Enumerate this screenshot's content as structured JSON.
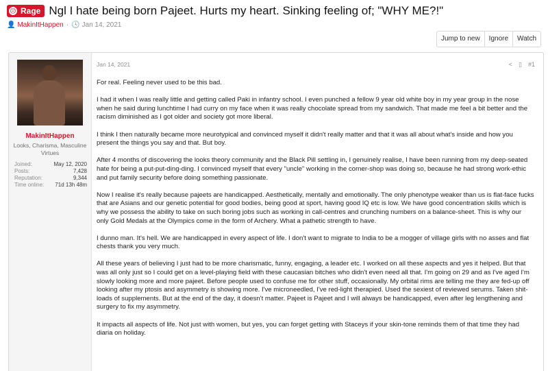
{
  "thread": {
    "prefix": "Rage",
    "prefix_color": "#d4172a",
    "title": "Ngl I hate being born Pajeet. Hurts my heart. Sinking feeling of; \"WHY ME?!\"",
    "author": "MakinItHappen",
    "date": "Jan 14, 2021",
    "author_icon": "user-icon",
    "date_icon": "clock-icon"
  },
  "actions": {
    "jump_to_new": "Jump to new",
    "ignore": "Ignore",
    "watch": "Watch"
  },
  "post": {
    "date": "Jan 14, 2021",
    "number": "#1",
    "share_icon": "share-icon",
    "bookmark_icon": "bookmark-icon",
    "user": {
      "name": "MakinItHappen",
      "title": "Looks, Charisma, Masculine Virtues",
      "stats": [
        {
          "label": "Joined:",
          "value": "May 12, 2020"
        },
        {
          "label": "Posts:",
          "value": "7,428"
        },
        {
          "label": "Reputation:",
          "value": "9,344"
        },
        {
          "label": "Time online:",
          "value": "71d 13h 48m"
        }
      ]
    },
    "paragraphs": [
      "For real. Feeling never used to be this bad.",
      "I had it when I was really little and getting called Paki in infantry school. I even punched a fellow 9 year old white boy in my year group in the nose when he said during lunchtime I had curry on my face when it was really chocolate spread from my sandwich. That made me feel a bit better and the racism diminished as I got older and society got more liberal.",
      "I think I then naturally became more neurotypical and convinced myself it didn't really matter and that it was all about what's inside and how you present the things you say and that. But boy.",
      "After 4 months of discovering the looks theory community and the Black Pill settling in, I genuinely realise, I have been running from my deep-seated hate for being a put-put-ding-ding. I convinced myself that every \"uncle\" working in the corner-shop was doing so, because he had strong work-ethic and put family security before doing something passionate.",
      "Now I realise it's really because pajeets are handicapped. Aesthetically, mentally and emotionally. The only phenotype weaker than us is flat-face fucks that are Asians and our genetic potential for good bodies, being good at sport, having good IQ etc is low. We have good concentration skills which is why we possess the ability to take on such boring jobs such as working in call-centres and crunching numbers on a balance-sheet. This is why our only Gold Medals at the Olympics come in the form of Archery. What a pathetic strength to have.",
      "I dunno man. It's hell. We are handicapped in every aspect of life. I don't want to migrate to India to be a mogger of village girls with no asses and flat chests thank you very much.",
      "All these years of believing I just had to be more charismatic, funny, engaging, a leader etc. I worked on all these aspects and yes it helped. But that was all only just so I could get on a level-playing field with these caucasian bitches who didn't even need all that. I'm going on 29 and as I've aged I'm slowly looking more and more pajeet. Before people used to confuse me for other stuff, occasionally. My orbital rims are telling me they are fed-up off looking after my ptosis and asymmetry is showing more. I've microneedled, I've red-light therapied. Used the sexiest of reviewed serums. Taken shit-loads of supplements. But at the end of the day, it doesn't matter. Pajeet is Pajeet and I will always be handicapped, even after leg lengthening and surgery to fix my asymmetry.",
      "It impacts all aspects of life. Not just with women, but yes, you can forget getting with Staceys if your skin-tone reminds them of that time they had diaria on holiday."
    ]
  }
}
